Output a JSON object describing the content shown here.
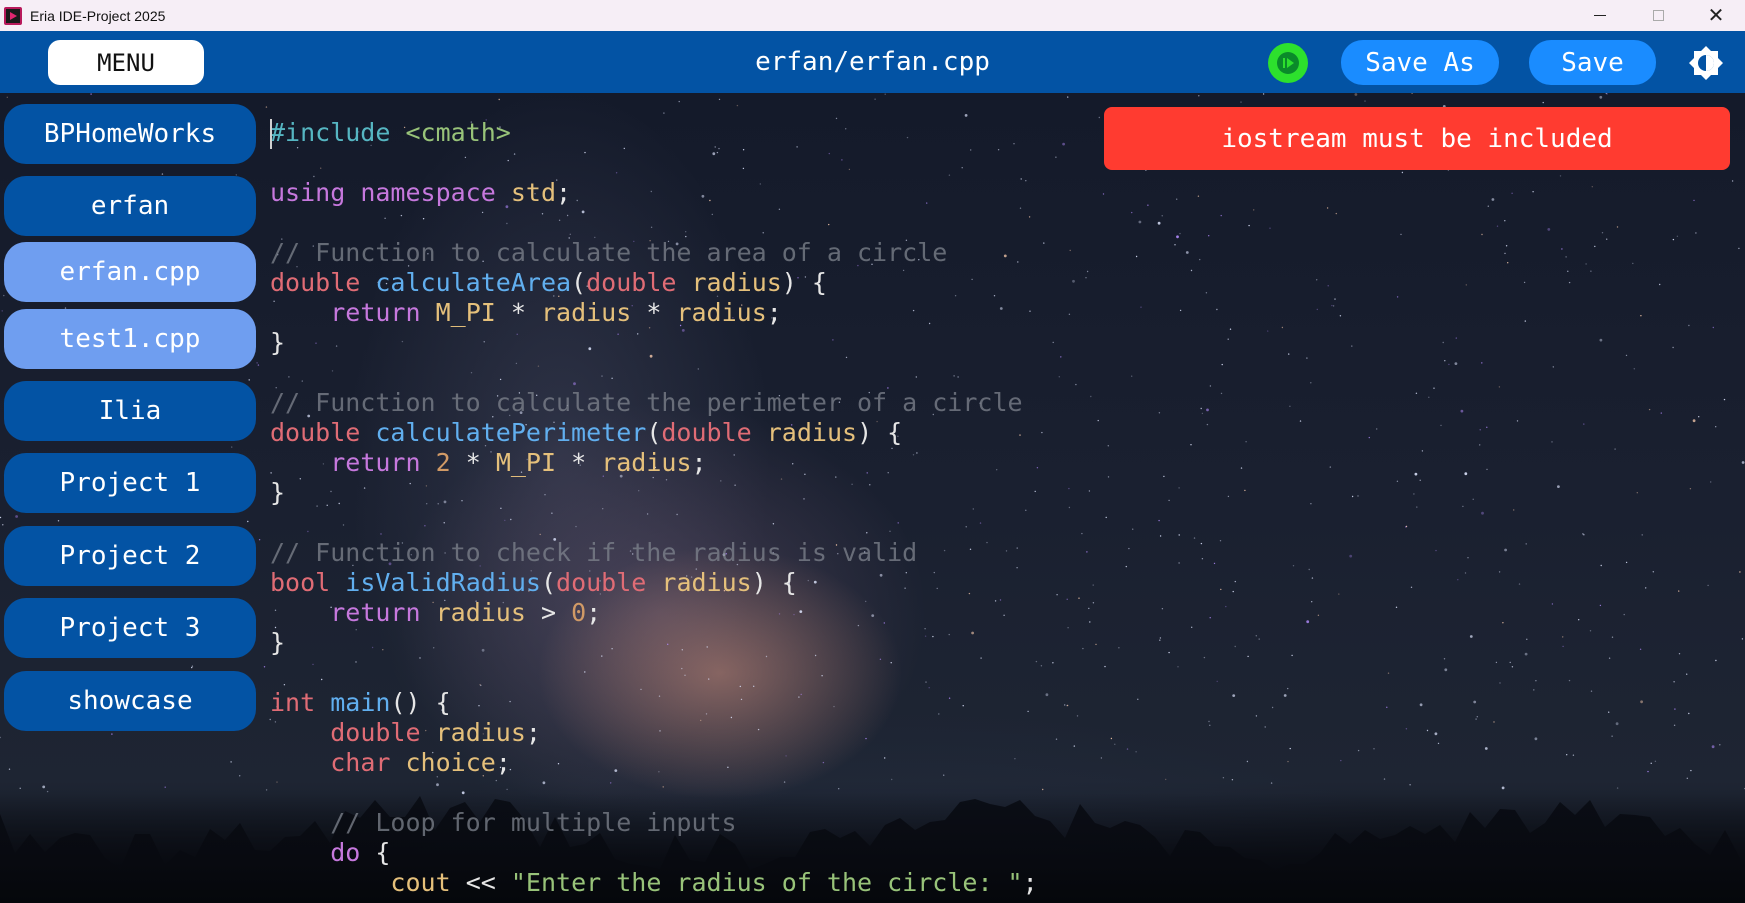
{
  "window": {
    "title": "Eria IDE-Project 2025",
    "close_glyph": "✕"
  },
  "header": {
    "menu_label": "MENU",
    "file_title": "erfan/erfan.cpp",
    "run_icon": "run-icon",
    "save_as_label": "Save As",
    "save_label": "Save",
    "theme_icon": "brightness-icon"
  },
  "sidebar": {
    "items": [
      {
        "label": "BPHomeWorks",
        "kind": "folder"
      },
      {
        "label": "erfan",
        "kind": "folder"
      },
      {
        "label": "erfan.cpp",
        "kind": "file"
      },
      {
        "label": "test1.cpp",
        "kind": "file"
      },
      {
        "label": "Ilia",
        "kind": "folder"
      },
      {
        "label": "Project 1",
        "kind": "folder"
      },
      {
        "label": "Project 2",
        "kind": "folder"
      },
      {
        "label": "Project 3",
        "kind": "folder"
      },
      {
        "label": "showcase",
        "kind": "folder"
      }
    ]
  },
  "error": {
    "message": "iostream must be included"
  },
  "colors": {
    "header_bg": "#0353a4",
    "folder_bg": "#0353a4",
    "file_bg": "#6f9ef0",
    "error_bg": "#ff3b30",
    "run_green": "#2de02d",
    "save_blue": "#1a8cff"
  },
  "editor": {
    "lines": [
      [
        [
          "pp",
          "#include"
        ],
        [
          "pn",
          " "
        ],
        [
          "inc",
          "<cmath>"
        ]
      ],
      [],
      [
        [
          "kw",
          "using"
        ],
        [
          "pn",
          " "
        ],
        [
          "kw",
          "namespace"
        ],
        [
          "pn",
          " "
        ],
        [
          "id",
          "std"
        ],
        [
          "pn",
          ";"
        ]
      ],
      [],
      [
        [
          "cm",
          "// Function to calculate the area of a circle"
        ]
      ],
      [
        [
          "ty",
          "double"
        ],
        [
          "pn",
          " "
        ],
        [
          "fn",
          "calculateArea"
        ],
        [
          "pn",
          "("
        ],
        [
          "ty",
          "double"
        ],
        [
          "pn",
          " "
        ],
        [
          "id",
          "radius"
        ],
        [
          "pn",
          ") {"
        ]
      ],
      [
        [
          "pn",
          "    "
        ],
        [
          "kw",
          "return"
        ],
        [
          "pn",
          " "
        ],
        [
          "id",
          "M_PI"
        ],
        [
          "pn",
          " * "
        ],
        [
          "id",
          "radius"
        ],
        [
          "pn",
          " * "
        ],
        [
          "id",
          "radius"
        ],
        [
          "pn",
          ";"
        ]
      ],
      [
        [
          "pn",
          "}"
        ]
      ],
      [],
      [
        [
          "cm",
          "// Function to calculate the perimeter of a circle"
        ]
      ],
      [
        [
          "ty",
          "double"
        ],
        [
          "pn",
          " "
        ],
        [
          "fn",
          "calculatePerimeter"
        ],
        [
          "pn",
          "("
        ],
        [
          "ty",
          "double"
        ],
        [
          "pn",
          " "
        ],
        [
          "id",
          "radius"
        ],
        [
          "pn",
          ") {"
        ]
      ],
      [
        [
          "pn",
          "    "
        ],
        [
          "kw",
          "return"
        ],
        [
          "pn",
          " "
        ],
        [
          "num",
          "2"
        ],
        [
          "pn",
          " * "
        ],
        [
          "id",
          "M_PI"
        ],
        [
          "pn",
          " * "
        ],
        [
          "id",
          "radius"
        ],
        [
          "pn",
          ";"
        ]
      ],
      [
        [
          "pn",
          "}"
        ]
      ],
      [],
      [
        [
          "cm",
          "// Function to check if the radius is valid"
        ]
      ],
      [
        [
          "ty",
          "bool"
        ],
        [
          "pn",
          " "
        ],
        [
          "fn",
          "isValidRadius"
        ],
        [
          "pn",
          "("
        ],
        [
          "ty",
          "double"
        ],
        [
          "pn",
          " "
        ],
        [
          "id",
          "radius"
        ],
        [
          "pn",
          ") {"
        ]
      ],
      [
        [
          "pn",
          "    "
        ],
        [
          "kw",
          "return"
        ],
        [
          "pn",
          " "
        ],
        [
          "id",
          "radius"
        ],
        [
          "pn",
          " > "
        ],
        [
          "num",
          "0"
        ],
        [
          "pn",
          ";"
        ]
      ],
      [
        [
          "pn",
          "}"
        ]
      ],
      [],
      [
        [
          "ty",
          "int"
        ],
        [
          "pn",
          " "
        ],
        [
          "fn",
          "main"
        ],
        [
          "pn",
          "() {"
        ]
      ],
      [
        [
          "pn",
          "    "
        ],
        [
          "ty",
          "double"
        ],
        [
          "pn",
          " "
        ],
        [
          "id",
          "radius"
        ],
        [
          "pn",
          ";"
        ]
      ],
      [
        [
          "pn",
          "    "
        ],
        [
          "ty",
          "char"
        ],
        [
          "pn",
          " "
        ],
        [
          "id",
          "choice"
        ],
        [
          "pn",
          ";"
        ]
      ],
      [],
      [
        [
          "pn",
          "    "
        ],
        [
          "cm",
          "// Loop for multiple inputs"
        ]
      ],
      [
        [
          "pn",
          "    "
        ],
        [
          "kw",
          "do"
        ],
        [
          "pn",
          " {"
        ]
      ],
      [
        [
          "pn",
          "        "
        ],
        [
          "id",
          "cout"
        ],
        [
          "pn",
          " << "
        ],
        [
          "str",
          "\"Enter the radius of the circle: \""
        ],
        [
          "pn",
          ";"
        ]
      ]
    ]
  }
}
